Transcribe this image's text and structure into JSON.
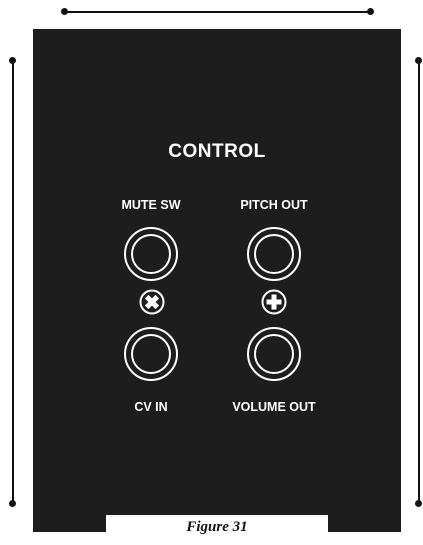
{
  "panel": {
    "title": "CONTROL",
    "jacks": [
      {
        "label": "MUTE SW"
      },
      {
        "label": "PITCH OUT"
      },
      {
        "label": "CV IN"
      },
      {
        "label": "VOLUME OUT"
      }
    ]
  },
  "caption": "Figure 31",
  "colors": {
    "panel": "#1d1d1d",
    "ink": "#ffffff",
    "dimension_lines": "#111111"
  }
}
